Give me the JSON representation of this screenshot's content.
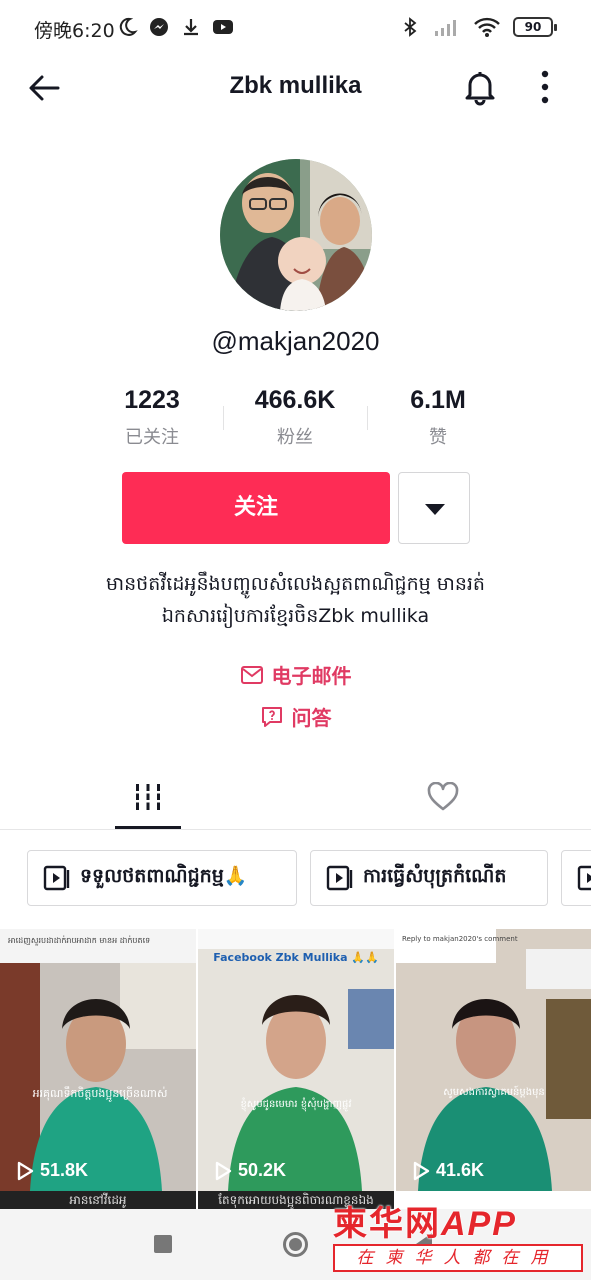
{
  "status_bar": {
    "time": "傍晚6:20",
    "battery": "90"
  },
  "header": {
    "title": "Zbk mullika"
  },
  "profile": {
    "username": "@makjan2020",
    "stats": [
      {
        "value": "1223",
        "label": "已关注"
      },
      {
        "value": "466.6K",
        "label": "粉丝"
      },
      {
        "value": "6.1M",
        "label": "赞"
      }
    ],
    "follow_label": "关注",
    "bio_line1": "មានថតវីដេអូនឹងបញ្ចូលសំលេងស្អតពាណិជ្ជកម្ម មានរត់",
    "bio_line2": "ឯកសាររៀបការខ្មែរចិនZbk mullika",
    "email_label": "电子邮件",
    "qa_label": "问答"
  },
  "playlists": [
    {
      "label": "ទទួលថតពាណិជ្ជកម្ម🙏"
    },
    {
      "label": "ការធ្វើសំបុត្រកំណើត"
    }
  ],
  "videos": [
    {
      "views": "51.8K",
      "caption_top": "អាដេញសួរបដាដាក់រាបអាដាក មានអ ដាក់បតទេ",
      "caption": "អរគុណទឹកចិត្តបងប្អូនច្រើនណាស់",
      "strip": "អាននៅវីដេអូ"
    },
    {
      "views": "50.2K",
      "caption_top": "Facebook Zbk Mullika 🙏🙏",
      "caption": "ខ្ញុំសូមជូនមេមារ ខ្ញុំសុំបង្ហាញផ្លូវ",
      "strip": "តែទុកអោយបងប្អូនពិចារណាខ្លួនឯង"
    },
    {
      "views": "41.6K",
      "caption_top": "Reply to makjan2020's comment",
      "caption": "សូមសងការស្វាគមន៍ម្តងមុន",
      "strip": ""
    }
  ],
  "watermark": {
    "main": "柬华网",
    "app": "APP",
    "sub": "在柬华人都在用"
  },
  "colors": {
    "accent": "#fe2c55",
    "link": "#e03a63",
    "watermark": "#e5262c"
  },
  "icons": [
    "back-arrow-icon",
    "bell-icon",
    "more-vert-icon",
    "chevron-down-icon",
    "mail-icon",
    "qa-icon",
    "grid-icon",
    "heart-icon",
    "playlist-icon",
    "play-icon"
  ]
}
